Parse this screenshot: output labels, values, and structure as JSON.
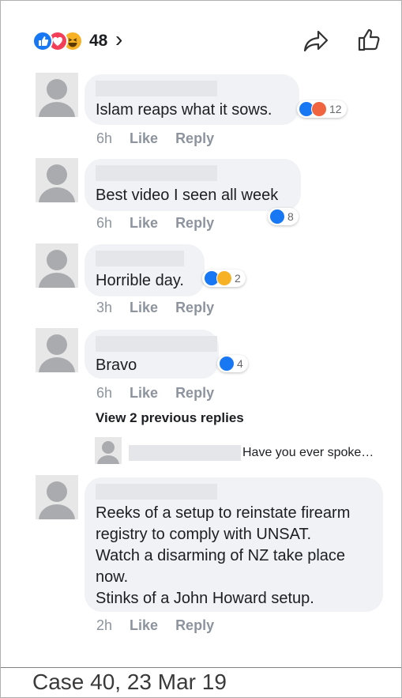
{
  "post": {
    "reaction_count": "48",
    "reaction_icons": [
      "like-icon",
      "love-icon",
      "haha-icon"
    ],
    "chevron": "›"
  },
  "comments": [
    {
      "text": "Islam reaps what it sows.",
      "time": "6h",
      "like": "Like",
      "reply": "Reply",
      "reaction_count": "12",
      "reactions": [
        "like",
        "angry"
      ]
    },
    {
      "text": "Best video I seen all week",
      "time": "6h",
      "like": "Like",
      "reply": "Reply",
      "reaction_count": "8",
      "reactions": [
        "like"
      ]
    },
    {
      "text": "Horrible day.",
      "time": "3h",
      "like": "Like",
      "reply": "Reply",
      "reaction_count": "2",
      "reactions": [
        "like",
        "haha"
      ]
    },
    {
      "text": "Bravo",
      "time": "6h",
      "like": "Like",
      "reply": "Reply",
      "reaction_count": "4",
      "reactions": [
        "like"
      ]
    },
    {
      "text_lines": [
        "Reeks of a setup to reinstate firearm",
        "registry to comply with UNSAT.",
        "Watch a disarming of NZ take place",
        "now.",
        "Stinks of a John Howard setup."
      ],
      "time": "2h",
      "like": "Like",
      "reply": "Reply"
    }
  ],
  "view_previous": "View 2 previous replies",
  "reply_snippet": "Have you ever spoke…",
  "caption": "Case 40, 23 Mar 19",
  "colors": {
    "like_blue": "#1877f2",
    "love_red": "#f33e58",
    "haha_yellow": "#f7b125",
    "angry_orange": "#f0643f",
    "bubble": "#f0f2f5",
    "meta_grey": "#8d949e"
  }
}
